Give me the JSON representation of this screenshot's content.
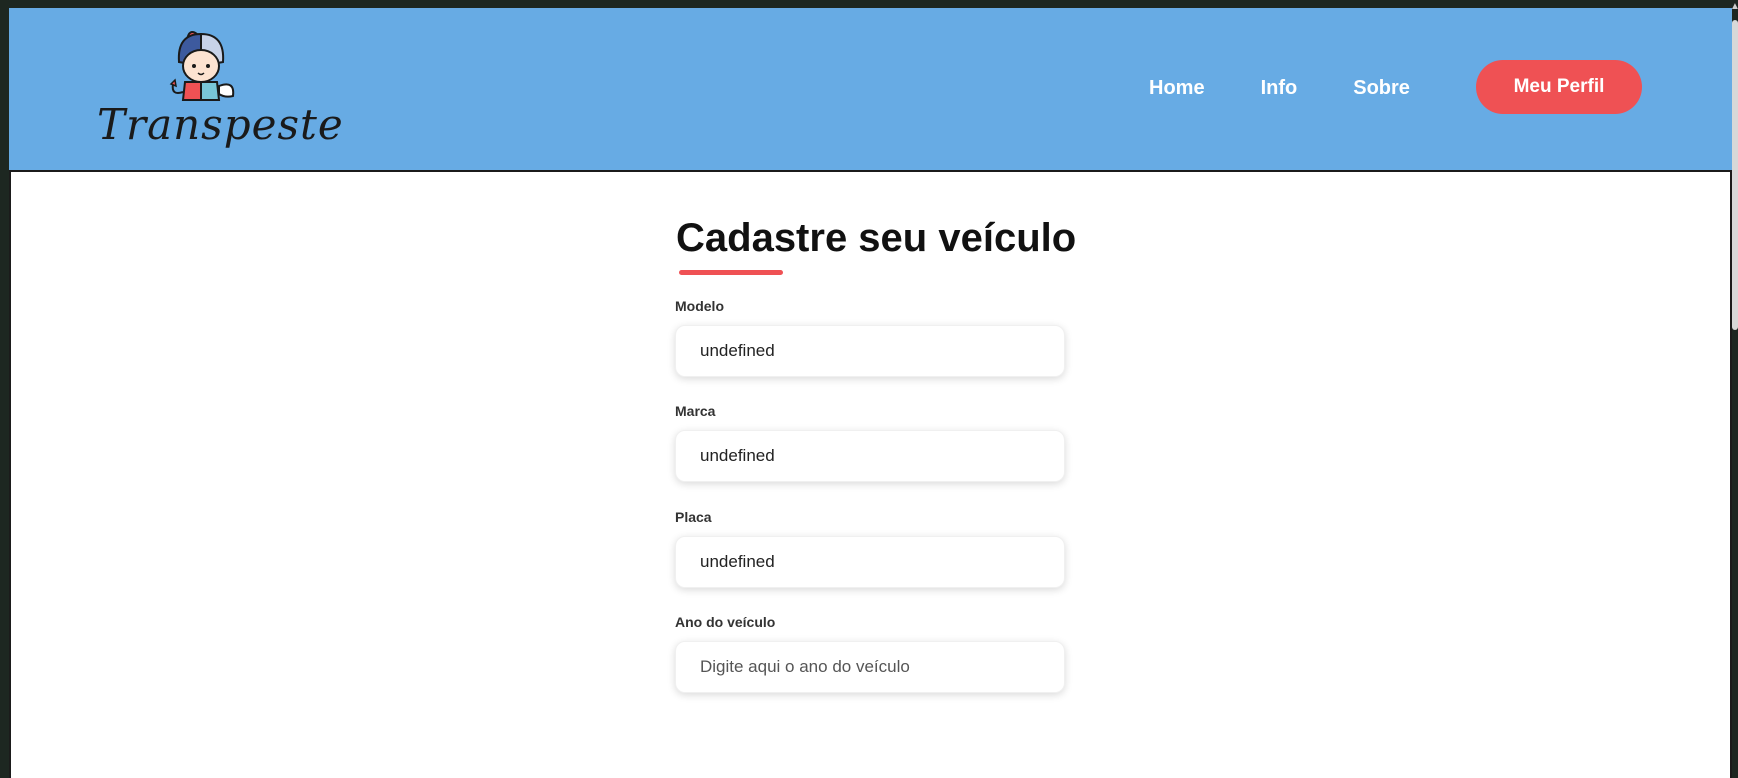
{
  "brand": {
    "name": "Transpeste"
  },
  "nav": {
    "items": [
      {
        "label": "Home"
      },
      {
        "label": "Info"
      },
      {
        "label": "Sobre"
      }
    ],
    "profile_button": "Meu Perfil"
  },
  "form": {
    "title": "Cadastre seu veículo",
    "fields": [
      {
        "label": "Modelo",
        "value": "undefined",
        "placeholder": ""
      },
      {
        "label": "Marca",
        "value": "undefined",
        "placeholder": ""
      },
      {
        "label": "Placa",
        "value": "undefined",
        "placeholder": ""
      },
      {
        "label": "Ano do veículo",
        "value": "",
        "placeholder": "Digite aqui o ano do veículo"
      }
    ]
  },
  "colors": {
    "header_bg": "#67abe4",
    "accent": "#ef5154"
  },
  "icons": {
    "logo": "angel-devil-mascot-icon",
    "scroll_up": "scroll-up-arrow-icon"
  }
}
